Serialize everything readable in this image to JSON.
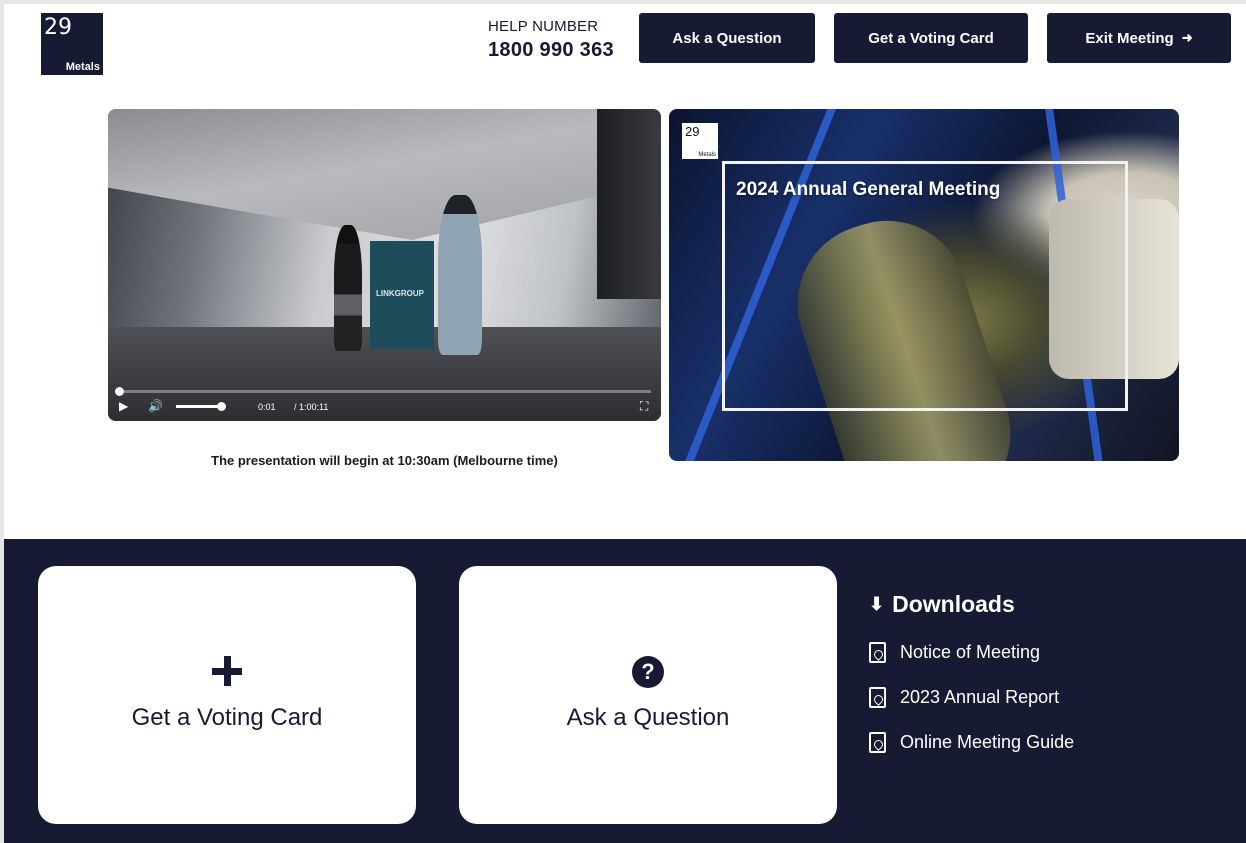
{
  "header": {
    "logo": {
      "number": "29",
      "word": "Metals"
    },
    "help": {
      "label": "HELP NUMBER",
      "number": "1800 990 363"
    },
    "buttons": {
      "ask": "Ask a Question",
      "voting": "Get a Voting Card",
      "exit": "Exit Meeting"
    }
  },
  "video": {
    "sign_text": "LINKGROUP",
    "current_time": "0:01",
    "duration": "/ 1:00:11",
    "progress": 0.0,
    "volume": 1.0,
    "caption": "The presentation will begin at 10:30am (Melbourne time)"
  },
  "slide": {
    "logo_number": "29",
    "logo_word": "Metals",
    "title": "2024 Annual General Meeting"
  },
  "cards": {
    "voting_label": "Get a Voting Card",
    "question_label": "Ask a Question"
  },
  "downloads": {
    "title": "Downloads",
    "items": [
      "Notice of Meeting",
      "2023 Annual Report",
      "Online Meeting Guide"
    ]
  },
  "colors": {
    "navy": "#161b33",
    "white": "#ffffff"
  }
}
